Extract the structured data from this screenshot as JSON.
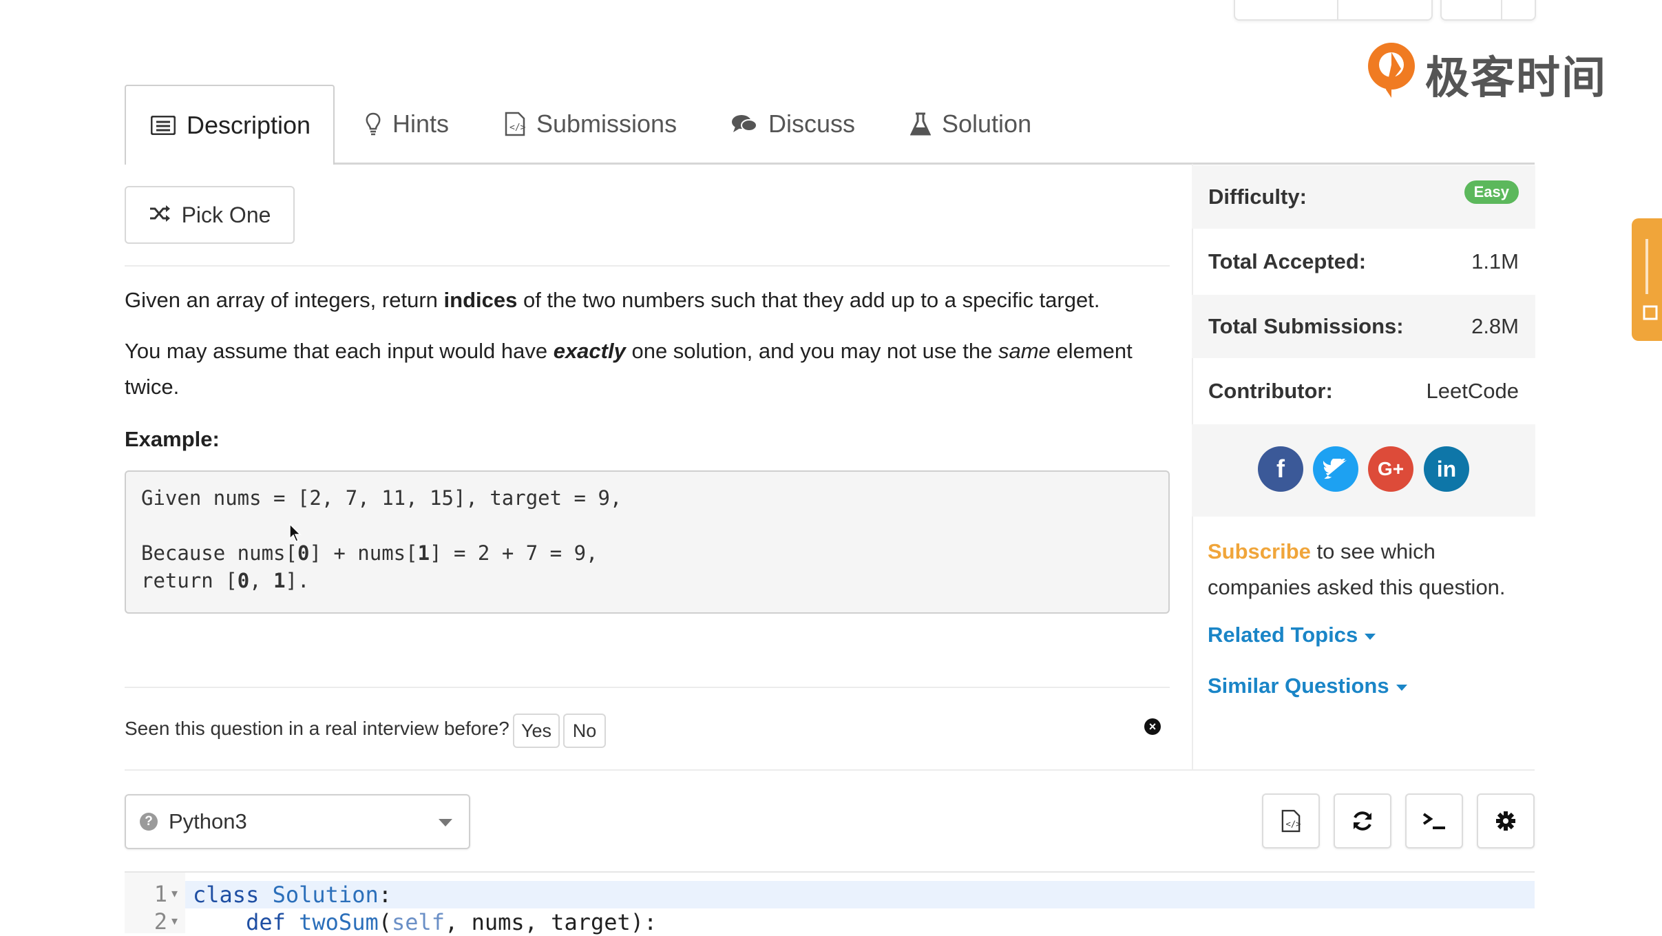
{
  "brand": {
    "name": "极客时间"
  },
  "tabs": [
    {
      "label": "Description",
      "icon": "list-icon"
    },
    {
      "label": "Hints",
      "icon": "lightbulb-icon"
    },
    {
      "label": "Submissions",
      "icon": "code-file-icon"
    },
    {
      "label": "Discuss",
      "icon": "comments-icon"
    },
    {
      "label": "Solution",
      "icon": "flask-icon"
    }
  ],
  "pick_one_label": "Pick One",
  "problem": {
    "p1_before": "Given an array of integers, return ",
    "p1_bold": "indices",
    "p1_after": " of the two numbers such that they add up to a specific target.",
    "p2_before": "You may assume that each input would have ",
    "p2_bolditalic": "exactly",
    "p2_middle": " one solution, and you may not use the ",
    "p2_italic": "same",
    "p2_after": " element twice.",
    "example_label": "Example:",
    "example_line1": "Given nums = [2, 7, 11, 15], target = 9,",
    "example_line3a": "Because nums[",
    "example_line3b": "0",
    "example_line3c": "] + nums[",
    "example_line3d": "1",
    "example_line3e": "] = 2 + 7 = 9,",
    "example_line4a": "return [",
    "example_line4b": "0",
    "example_line4c": ", ",
    "example_line4d": "1",
    "example_line4e": "]."
  },
  "interview": {
    "question": "Seen this question in a real interview before?",
    "yes": "Yes",
    "no": "No"
  },
  "sidebar": {
    "difficulty_label": "Difficulty:",
    "difficulty_value": "Easy",
    "accepted_label": "Total Accepted:",
    "accepted_value": "1.1M",
    "submissions_label": "Total Submissions:",
    "submissions_value": "2.8M",
    "contributor_label": "Contributor:",
    "contributor_value": "LeetCode",
    "social": [
      {
        "name": "facebook",
        "glyph": "f",
        "color": "#3b5998"
      },
      {
        "name": "twitter",
        "glyph": "t",
        "color": "#1da1f2"
      },
      {
        "name": "google-plus",
        "glyph": "G+",
        "color": "#dd4b39"
      },
      {
        "name": "linkedin",
        "glyph": "in",
        "color": "#0e76a8"
      }
    ],
    "subscribe_link": "Subscribe",
    "subscribe_rest": " to see which companies asked this question.",
    "related_topics": "Related Topics",
    "similar_questions": "Similar Questions"
  },
  "editor": {
    "language": "Python3",
    "lines": [
      {
        "num": "1",
        "kw": "class",
        "rest_a": " ",
        "cls": "Solution",
        "rest_b": ":"
      },
      {
        "num": "2",
        "indent": "    ",
        "kw": "def",
        "rest_a": " ",
        "cls": "twoSum",
        "rest_b": "(",
        "slf": "self",
        "rest_c": ", nums, target):"
      }
    ]
  },
  "colors": {
    "accent_blue": "#1a85c7",
    "easy_green": "#5cb85c",
    "subscribe_orange": "#f0a53a"
  }
}
